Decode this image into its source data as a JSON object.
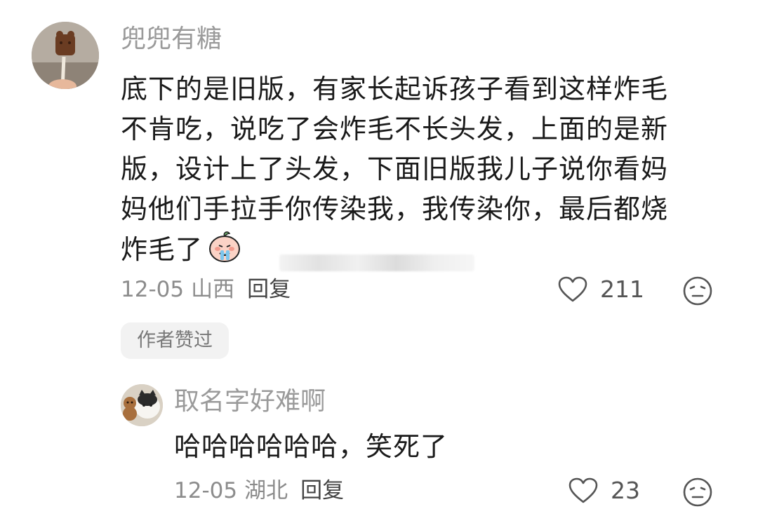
{
  "comment": {
    "username": "兜兜有糖",
    "lines": [
      "底下的是旧版，有家长起诉孩子看到这样炸毛",
      "不肯吃，说吃了会炸毛不长头发，上面的是新",
      "版，设计上了头发，下面旧版我儿子说你看妈",
      "妈他们手拉手你传染我，我传染你，最后都烧",
      "炸毛了"
    ],
    "date": "12-05",
    "location": "山西",
    "reply_label": "回复",
    "likes": "211",
    "author_badge": "作者赞过"
  },
  "reply": {
    "username": "取名字好难啊",
    "text": "哈哈哈哈哈哈，笑死了",
    "date": "12-05",
    "location": "湖北",
    "reply_label": "回复",
    "likes": "23"
  },
  "icons": {
    "like": "heart-outline-icon",
    "emoji": "neutral-face-icon",
    "sticker": "crying-peach-sticker"
  },
  "colors": {
    "username": "#9a9a9a",
    "text": "#1a1a1a",
    "meta": "#8c8c8c",
    "badge_bg": "#f2f2f2"
  }
}
